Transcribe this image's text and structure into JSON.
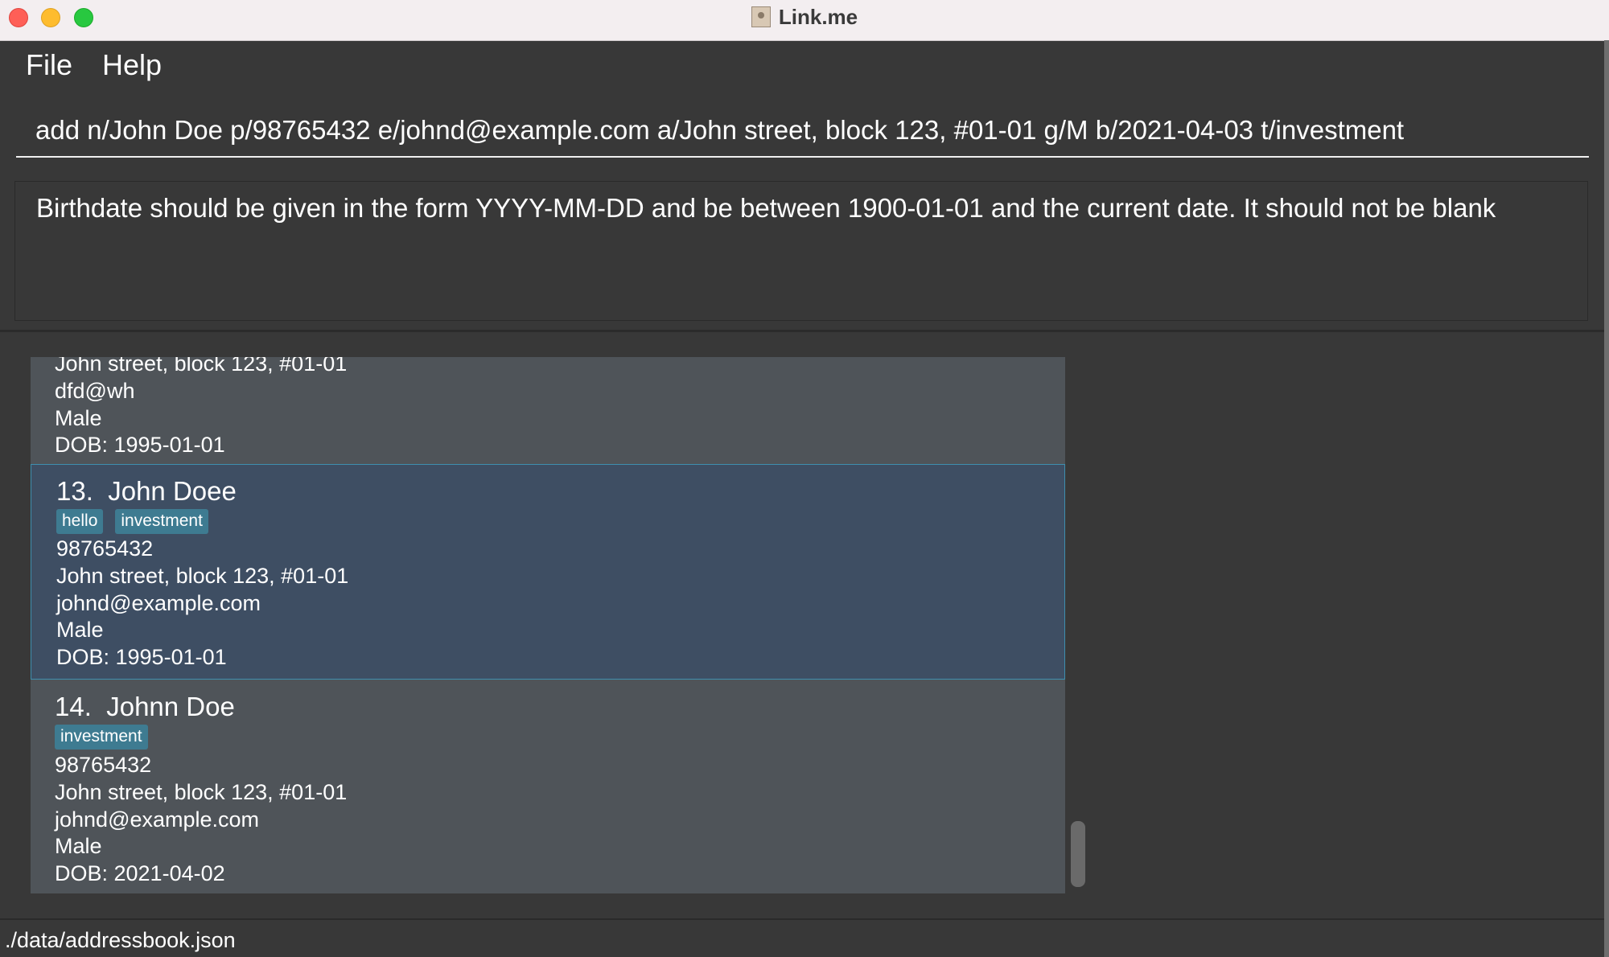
{
  "window": {
    "title": "Link.me"
  },
  "menu": {
    "file": "File",
    "help": "Help"
  },
  "command": {
    "value": "add n/John Doe p/98765432 e/johnd@example.com a/John street, block 123, #01-01 g/M b/2021-04-03 t/investment"
  },
  "result": {
    "message": "Birthdate should be given in the form YYYY-MM-DD and be between 1900-01-01 and the current date. It should not be blank"
  },
  "persons": [
    {
      "address": "John street, block 123, #01-01",
      "email": "dfd@wh",
      "gender": "Male",
      "dob": "DOB: 1995-01-01"
    },
    {
      "index": "13.",
      "name": "John Doee",
      "tags": [
        "hello",
        "investment"
      ],
      "phone": "98765432",
      "address": "John street, block 123, #01-01",
      "email": "johnd@example.com",
      "gender": "Male",
      "dob": "DOB: 1995-01-01"
    },
    {
      "index": "14.",
      "name": "Johnn Doe",
      "tags": [
        "investment"
      ],
      "phone": "98765432",
      "address": "John street, block 123, #01-01",
      "email": "johnd@example.com",
      "gender": "Male",
      "dob": "DOB: 2021-04-02"
    }
  ],
  "status": {
    "filepath": "./data/addressbook.json"
  },
  "colors": {
    "background": "#383838",
    "card": "#4f5459",
    "card_selected": "#3e4e63",
    "selected_border": "#3e8fae",
    "tag": "#3e7b91"
  }
}
